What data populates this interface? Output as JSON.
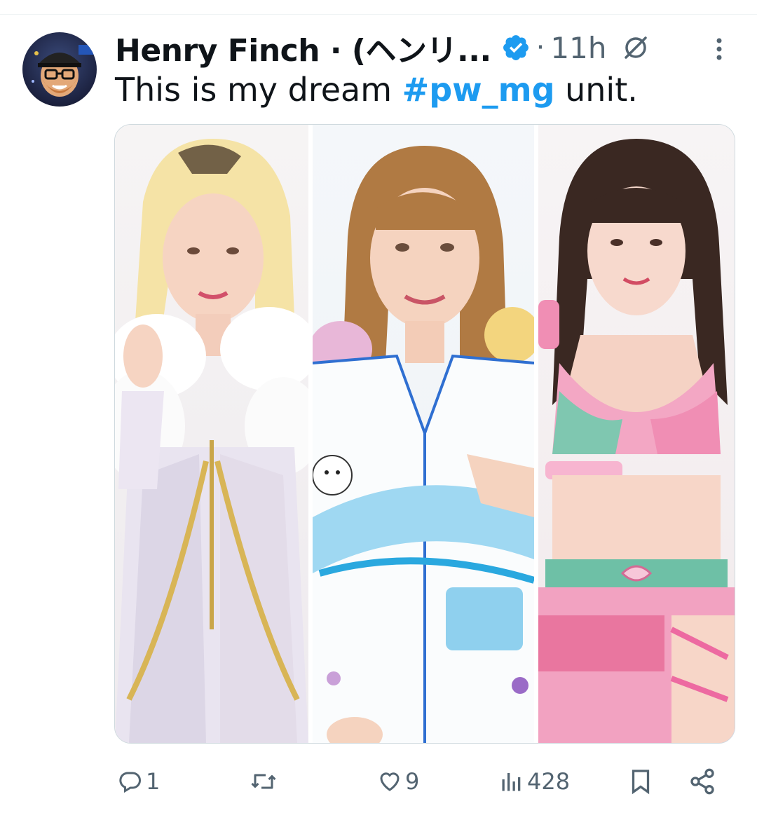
{
  "tweet": {
    "author_name": "Henry Finch · (ヘンリ...",
    "separator": "·",
    "timestamp": "11h",
    "text_before": "This is my dream ",
    "hashtag": "#pw_mg",
    "text_after": " unit."
  },
  "media": {
    "panels": [
      {
        "name": "photo-wrestler-left",
        "description_icon": "photo"
      },
      {
        "name": "photo-wrestler-center",
        "description_icon": "photo"
      },
      {
        "name": "photo-wrestler-right",
        "description_icon": "photo"
      }
    ]
  },
  "actions": {
    "replies": "1",
    "reposts": "",
    "likes": "9",
    "views": "428"
  },
  "colors": {
    "accent": "#1d9bf0",
    "secondary_text": "#536471",
    "primary_text": "#0f1419"
  },
  "icons": [
    "verified-badge-icon",
    "grok-icon",
    "more-options-icon",
    "reply-icon",
    "repost-icon",
    "like-icon",
    "views-icon",
    "bookmark-icon",
    "share-icon"
  ]
}
